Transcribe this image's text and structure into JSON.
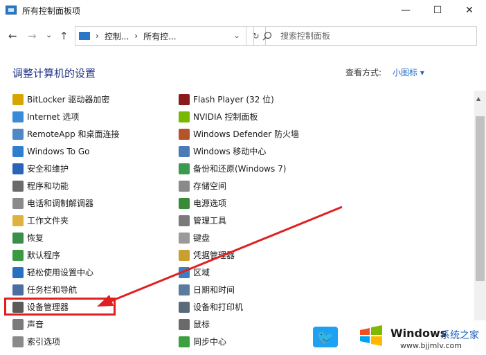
{
  "window": {
    "title": "所有控制面板项",
    "minimize": "—",
    "maximize": "☐",
    "close": "✕"
  },
  "nav": {
    "back": "←",
    "forward": "→",
    "recent": "⌄",
    "up": "↑"
  },
  "address": {
    "seg1": "控制...",
    "sep": "›",
    "seg2": "所有控...",
    "dropdown": "⌄",
    "refresh": "↻"
  },
  "search": {
    "placeholder": "搜索控制面板"
  },
  "heading": "调整计算机的设置",
  "view": {
    "label": "查看方式:",
    "value": "小图标 ▾"
  },
  "left_items": [
    {
      "label": "BitLocker 驱动器加密",
      "icon": "bitlocker-icon",
      "color": "#d9a400"
    },
    {
      "label": "Internet 选项",
      "icon": "internet-icon",
      "color": "#3a8ad6"
    },
    {
      "label": "RemoteApp 和桌面连接",
      "icon": "remoteapp-icon",
      "color": "#4f88c6"
    },
    {
      "label": "Windows To Go",
      "icon": "windows-to-go-icon",
      "color": "#2f7fd0"
    },
    {
      "label": "安全和维护",
      "icon": "flag-icon",
      "color": "#2a64b8"
    },
    {
      "label": "程序和功能",
      "icon": "programs-icon",
      "color": "#6b6b6b"
    },
    {
      "label": "电话和调制解调器",
      "icon": "modem-icon",
      "color": "#8a8a8a"
    },
    {
      "label": "工作文件夹",
      "icon": "work-folders-icon",
      "color": "#e0b040"
    },
    {
      "label": "恢复",
      "icon": "recovery-icon",
      "color": "#3b8e4a"
    },
    {
      "label": "默认程序",
      "icon": "default-programs-icon",
      "color": "#3a9a40"
    },
    {
      "label": "轻松使用设置中心",
      "icon": "ease-of-access-icon",
      "color": "#2a70c0"
    },
    {
      "label": "任务栏和导航",
      "icon": "taskbar-icon",
      "color": "#4a6fa0"
    },
    {
      "label": "设备管理器",
      "icon": "device-manager-icon",
      "color": "#5a5a5a"
    },
    {
      "label": "声音",
      "icon": "speaker-icon",
      "color": "#7a7a7a"
    },
    {
      "label": "索引选项",
      "icon": "indexing-icon",
      "color": "#8a8a8a"
    }
  ],
  "right_items": [
    {
      "label": "Flash Player (32 位)",
      "icon": "flash-icon",
      "color": "#8b1a1a"
    },
    {
      "label": "NVIDIA 控制面板",
      "icon": "nvidia-icon",
      "color": "#76b900"
    },
    {
      "label": "Windows Defender 防火墙",
      "icon": "firewall-icon",
      "color": "#b5542a"
    },
    {
      "label": "Windows 移动中心",
      "icon": "mobility-icon",
      "color": "#4a7ab8"
    },
    {
      "label": "备份和还原(Windows 7)",
      "icon": "backup-icon",
      "color": "#3a9a50"
    },
    {
      "label": "存储空间",
      "icon": "storage-icon",
      "color": "#8a8a8a"
    },
    {
      "label": "电源选项",
      "icon": "power-icon",
      "color": "#3a8a3a"
    },
    {
      "label": "管理工具",
      "icon": "admin-tools-icon",
      "color": "#7a7a7a"
    },
    {
      "label": "键盘",
      "icon": "keyboard-icon",
      "color": "#9a9a9a"
    },
    {
      "label": "凭据管理器",
      "icon": "credential-icon",
      "color": "#c9a030"
    },
    {
      "label": "区域",
      "icon": "region-icon",
      "color": "#3a80c0"
    },
    {
      "label": "日期和时间",
      "icon": "clock-icon",
      "color": "#5a7aa0"
    },
    {
      "label": "设备和打印机",
      "icon": "printer-icon",
      "color": "#5a6a7a"
    },
    {
      "label": "鼠标",
      "icon": "mouse-icon",
      "color": "#6a6a6a"
    },
    {
      "label": "同步中心",
      "icon": "sync-icon",
      "color": "#3aa040"
    }
  ],
  "watermark": {
    "brand": "Windows",
    "brand2": "系统之家",
    "url": "www.bjjmlv.com"
  }
}
